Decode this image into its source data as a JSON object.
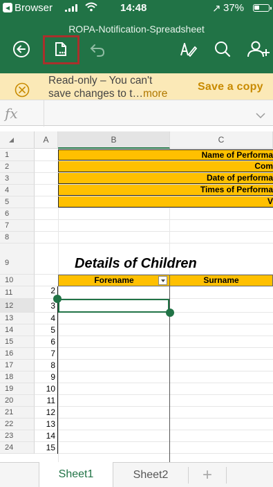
{
  "status_bar": {
    "back_app": "Browser",
    "time": "14:48",
    "location_arrow": "↗",
    "battery_percent": "37%"
  },
  "header": {
    "document_title": "ROPA-Notification-Spreadsheet",
    "icons": [
      "back-circle-icon",
      "file-info-icon",
      "undo-icon",
      "draw-pen-icon",
      "search-icon",
      "share-person-icon"
    ]
  },
  "banner": {
    "line1": "Read-only – You can't",
    "line2": "save changes to t…",
    "more": "more",
    "save_copy": "Save a copy"
  },
  "formula_bar": {
    "fx": "fx",
    "value": ""
  },
  "grid": {
    "columns": [
      "A",
      "B",
      "C"
    ],
    "selected_column": "B",
    "rows": [
      "1",
      "2",
      "3",
      "4",
      "5",
      "6",
      "7",
      "8",
      "9",
      "10",
      "11",
      "12",
      "13",
      "14",
      "15",
      "16",
      "17",
      "18",
      "19",
      "20",
      "21",
      "22",
      "23",
      "24"
    ],
    "selected_row": "12",
    "info_labels": [
      "Name of Performa",
      "Com",
      "Date of performa",
      "Times of Performa",
      "V"
    ],
    "section_title": "Details of Children",
    "table_headers": [
      "Forename",
      "Surname"
    ],
    "numbers": [
      "2",
      "3",
      "4",
      "5",
      "6",
      "7",
      "8",
      "9",
      "10",
      "11",
      "12",
      "13",
      "14",
      "15"
    ]
  },
  "tabs": {
    "items": [
      "Sheet1",
      "Sheet2"
    ],
    "active": "Sheet1",
    "add": "+"
  },
  "colors": {
    "excel_green": "#217346",
    "banner_bg": "#fbe9b7",
    "cell_orange": "#ffc000",
    "highlight_red": "#a9302c"
  }
}
